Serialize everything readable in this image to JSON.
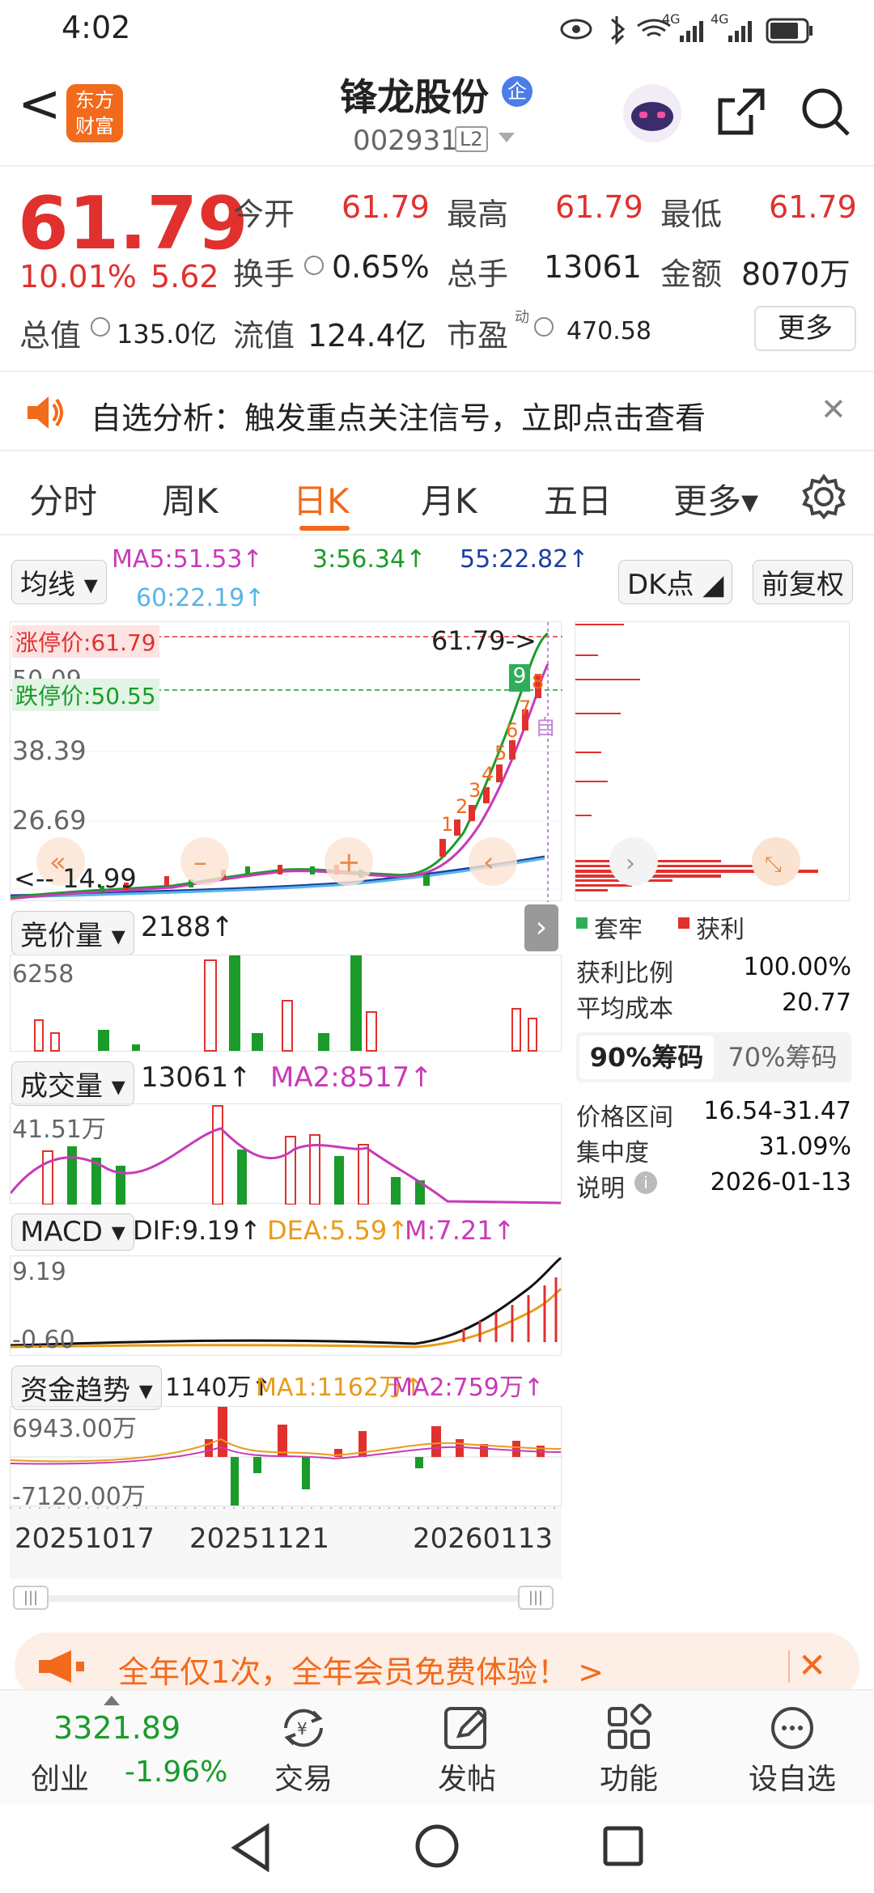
{
  "status_bar": {
    "time": "4:02",
    "net1": "4G",
    "net2": "4G"
  },
  "header": {
    "back": "<",
    "logo_top": "东方",
    "logo_bottom": "财富",
    "stock_name": "锋龙股份",
    "badge": "企",
    "stock_code": "002931",
    "level": "L2"
  },
  "quote": {
    "price": "61.79",
    "change_pct": "10.01%",
    "change_amt": "5.62",
    "open_label": "今开",
    "open": "61.79",
    "high_label": "最高",
    "high": "61.79",
    "low_label": "最低",
    "low": "61.79",
    "turnover_label": "换手",
    "turnover": "0.65%",
    "volume_label": "总手",
    "volume": "13061",
    "amount_label": "金额",
    "amount": "8070万",
    "mktcap_label": "总值",
    "mktcap": "135.0亿",
    "float_label": "流值",
    "float_cap": "124.4亿",
    "pe_label": "市盈",
    "pe_sup": "动",
    "pe": "470.58",
    "more": "更多"
  },
  "notice": {
    "text": "自选分析：触发重点关注信号，立即点击查看",
    "close": "✕"
  },
  "tabs": [
    {
      "label": "分时",
      "active": false
    },
    {
      "label": "周K",
      "active": false
    },
    {
      "label": "日K",
      "active": true
    },
    {
      "label": "月K",
      "active": false
    },
    {
      "label": "五日",
      "active": false
    },
    {
      "label": "更多▾",
      "active": false
    }
  ],
  "ma_bar": {
    "selector": "均线",
    "ma5": "MA5:51.53↑",
    "ma3": "3:56.34↑",
    "ma55": "55:22.82↑",
    "ma60": "60:22.19↑",
    "dk": "DK点",
    "adjust": "前复权"
  },
  "kline": {
    "limit_up": "涨停价:61.79",
    "limit_down": "跌停价:50.55",
    "y1": "50.09",
    "y2": "38.39",
    "y3": "26.69",
    "last_marker": "61.79->",
    "low_marker": "<-- 14.99",
    "signal_top": "9",
    "signal_numbers": [
      "1",
      "2",
      "3",
      "4",
      "5",
      "6",
      "7",
      "8"
    ],
    "zi": "自"
  },
  "chart_data": {
    "type": "line",
    "x": [
      "20251017",
      "20251121",
      "20260113"
    ],
    "series": [
      {
        "name": "MA5",
        "values": [
          16.5,
          17.0,
          51.53
        ]
      },
      {
        "name": "3",
        "values": [
          16.2,
          16.8,
          56.34
        ]
      },
      {
        "name": "55",
        "values": [
          15.4,
          16.3,
          22.82
        ]
      },
      {
        "name": "60",
        "values": [
          15.3,
          16.2,
          22.19
        ]
      }
    ]
  },
  "auction": {
    "selector": "竞价量",
    "value": "2188↑",
    "ymax": "6258"
  },
  "volume": {
    "selector": "成交量",
    "value": "13061↑",
    "ma2": "MA2:8517↑",
    "ymax": "41.51万"
  },
  "macd": {
    "selector": "MACD",
    "dif": "DIF:9.19↑",
    "dea": "DEA:5.59↑",
    "m": "M:7.21↑",
    "ymax": "9.19",
    "ymin": "-0.60"
  },
  "capital": {
    "selector": "资金趋势",
    "value": "1140万↑",
    "ma1": "MA1:1162万↑",
    "ma2": "MA2:759万↑",
    "ymax": "6943.00万",
    "ymin": "-7120.00万"
  },
  "dates": {
    "d1": "20251017",
    "d2": "20251121",
    "d3": "20260113"
  },
  "chips": {
    "legend_hold": "套牢",
    "legend_profit": "获利",
    "profit_ratio_label": "获利比例",
    "profit_ratio": "100.00%",
    "avg_cost_label": "平均成本",
    "avg_cost": "20.77",
    "tab90": "90%筹码",
    "tab70": "70%筹码",
    "range_label": "价格区间",
    "range": "16.54-31.47",
    "conc_label": "集中度",
    "conc": "31.09%",
    "note_label": "说明",
    "note_date": "2026-01-13"
  },
  "promo": {
    "text": "全年仅1次，全年会员免费体验！ >",
    "close": "✕"
  },
  "bottom_nav": {
    "index_value": "3321.89",
    "index_name": "创业",
    "index_change": "-1.96%",
    "trade": "交易",
    "post": "发帖",
    "func": "功能",
    "watch": "设自选"
  },
  "colors": {
    "up": "#e0312e",
    "down": "#1a9b2a",
    "accent": "#f26a1b"
  }
}
